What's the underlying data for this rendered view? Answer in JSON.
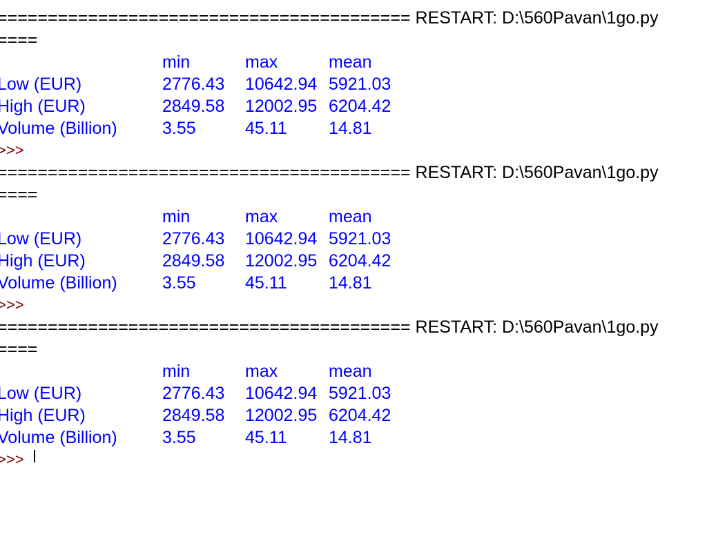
{
  "shell": {
    "runs": [
      {
        "restart_line": "========================================= RESTART: D:\\560Pavan\\1go.py",
        "restart_cont": "====",
        "headers": [
          "min",
          "max",
          "mean"
        ],
        "rows": [
          {
            "label": "Low (EUR)",
            "min": "2776.43",
            "max": "10642.94",
            "mean": "5921.03"
          },
          {
            "label": "High (EUR)",
            "min": "2849.58",
            "max": "12002.95",
            "mean": "6204.42"
          },
          {
            "label": "Volume (Billion)",
            "min": "3.55",
            "max": "45.11",
            "mean": "14.81"
          }
        ],
        "prompt": ">>> "
      },
      {
        "restart_line": "========================================= RESTART: D:\\560Pavan\\1go.py",
        "restart_cont": "====",
        "headers": [
          "min",
          "max",
          "mean"
        ],
        "rows": [
          {
            "label": "Low (EUR)",
            "min": "2776.43",
            "max": "10642.94",
            "mean": "5921.03"
          },
          {
            "label": "High (EUR)",
            "min": "2849.58",
            "max": "12002.95",
            "mean": "6204.42"
          },
          {
            "label": "Volume (Billion)",
            "min": "3.55",
            "max": "45.11",
            "mean": "14.81"
          }
        ],
        "prompt": ">>> "
      },
      {
        "restart_line": "========================================= RESTART: D:\\560Pavan\\1go.py",
        "restart_cont": "====",
        "headers": [
          "min",
          "max",
          "mean"
        ],
        "rows": [
          {
            "label": "Low (EUR)",
            "min": "2776.43",
            "max": "10642.94",
            "mean": "5921.03"
          },
          {
            "label": "High (EUR)",
            "min": "2849.58",
            "max": "12002.95",
            "mean": "6204.42"
          },
          {
            "label": "Volume (Billion)",
            "min": "3.55",
            "max": "45.11",
            "mean": "14.81"
          }
        ],
        "prompt": ">>> "
      }
    ]
  },
  "colors": {
    "output": "#0000ff",
    "prompt": "#800000",
    "text": "#000000",
    "background": "#ffffff"
  }
}
